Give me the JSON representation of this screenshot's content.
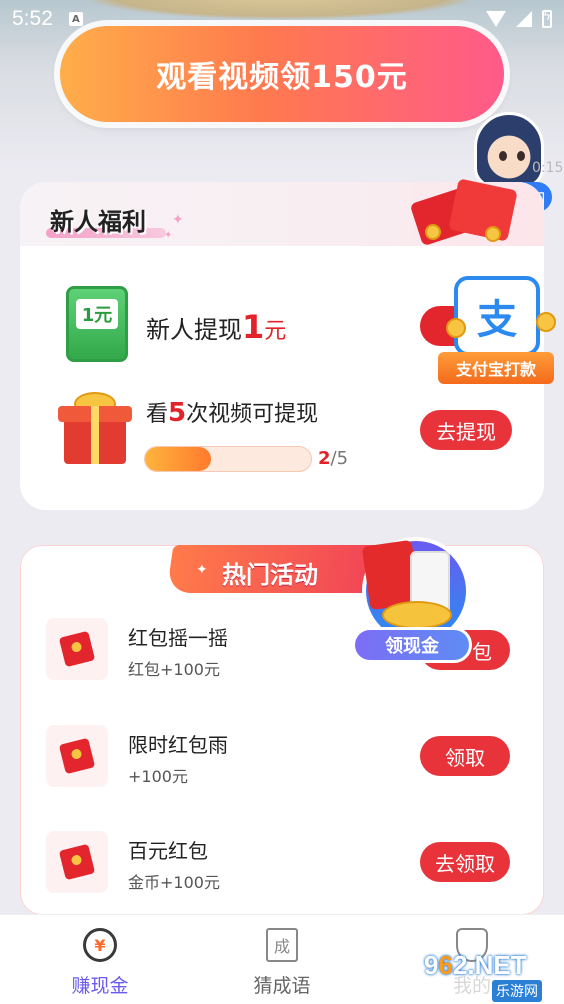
{
  "status_bar": {
    "time": "5:52",
    "badge": "A"
  },
  "banner": {
    "label": "观看视频领150元"
  },
  "service": {
    "button_label": "口",
    "time_hint": "0:15"
  },
  "newbie": {
    "title": "新人福利",
    "withdraw": {
      "prefix": "新人提现",
      "amount": "1",
      "unit": "元",
      "icon_text": "1元"
    },
    "alipay": {
      "glyph": "支",
      "label": "支付宝打款"
    },
    "video_task": {
      "prefix": "看",
      "count": "5",
      "suffix": "次视频可提现"
    },
    "progress": {
      "current": "2",
      "total": "/5",
      "fraction": 0.4
    },
    "withdraw_button": "去提现"
  },
  "hot": {
    "title": "热门活动",
    "float_label": "领现金",
    "items": [
      {
        "title": "红包摇一摇",
        "sub": "红包+100元",
        "button": "包"
      },
      {
        "title": "限时红包雨",
        "sub": "+100元",
        "button": "领取"
      },
      {
        "title": "百元红包",
        "sub": "金币+100元",
        "button": "去领取"
      }
    ]
  },
  "nav": {
    "items": [
      {
        "label": "赚现金",
        "icon_text": "¥",
        "active": true
      },
      {
        "label": "猜成语",
        "icon_text": "成",
        "active": false
      },
      {
        "label": "我的",
        "active": false
      }
    ],
    "active_color": "#6a5af0"
  },
  "watermark": {
    "main_prefix": "9",
    "main_o": "6",
    "main_suffix": "2.NET",
    "sub": "乐游网"
  }
}
